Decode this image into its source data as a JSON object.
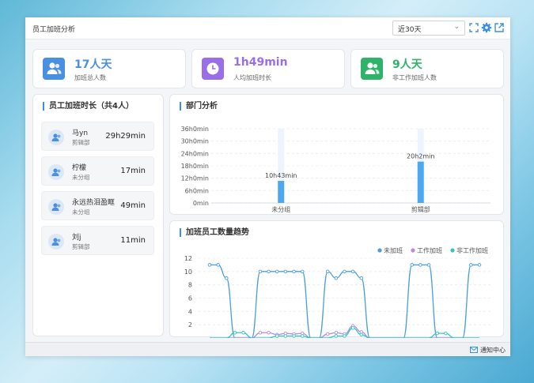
{
  "header": {
    "title": "员工加班分析",
    "range_selected": "近30天"
  },
  "stats": [
    {
      "value": "17人天",
      "label": "加班总人数",
      "color": "#4a90e2",
      "icon": "users-icon"
    },
    {
      "value": "1h49min",
      "label": "人均加班时长",
      "color": "#9a6ee6",
      "icon": "clock-icon"
    },
    {
      "value": "9人天",
      "label": "非工作加班人数",
      "color": "#2fb36b",
      "icon": "users-icon"
    }
  ],
  "employee_panel": {
    "title": "员工加班时长（共4人）",
    "items": [
      {
        "name": "马yn",
        "dept": "剪辑部",
        "duration": "29h29min"
      },
      {
        "name": "柠檬",
        "dept": "未分组",
        "duration": "17min"
      },
      {
        "name": "永远热泪盈眶",
        "dept": "未分组",
        "duration": "49min"
      },
      {
        "name": "刘j",
        "dept": "剪辑部",
        "duration": "11min"
      }
    ]
  },
  "dept_panel": {
    "title": "部门分析"
  },
  "trend_panel": {
    "title": "加班员工数量趋势"
  },
  "footer": {
    "notify_label": "通知中心"
  },
  "chart_data": [
    {
      "type": "bar",
      "categories": [
        "未分组",
        "剪辑部"
      ],
      "values": [
        10.72,
        20.03
      ],
      "value_labels": [
        "10h43min",
        "20h2min"
      ],
      "y_ticks": [
        "0min",
        "6h0min",
        "12h0min",
        "18h0min",
        "24h0min",
        "30h0min",
        "36h0min"
      ],
      "ylim": [
        0,
        36
      ],
      "color": "#4ea8f0"
    },
    {
      "type": "line",
      "y_ticks": [
        "2",
        "4",
        "6",
        "8",
        "10",
        "12"
      ],
      "ylim": [
        0,
        12
      ],
      "legend_position": "top-right",
      "series": [
        {
          "name": "未加班",
          "color": "#4a9fe0",
          "values": [
            11,
            11,
            9,
            0,
            0,
            0,
            10,
            10,
            10,
            10,
            10,
            10,
            0,
            0,
            10,
            9,
            10,
            10,
            9,
            0,
            0,
            0,
            0,
            0,
            11,
            11,
            11,
            0,
            0,
            0,
            0,
            11,
            11
          ]
        },
        {
          "name": "工作加班",
          "color": "#b58ae0",
          "values": [
            0,
            0,
            0,
            0,
            0,
            0,
            0.8,
            0.8,
            0.5,
            0.7,
            0.6,
            0.7,
            0,
            0,
            0.6,
            0.8,
            0.6,
            1.8,
            0.9,
            0,
            0,
            0,
            0,
            0,
            0,
            0,
            0,
            0,
            0,
            0,
            0,
            0,
            0
          ]
        },
        {
          "name": "非工作加班",
          "color": "#34c5c0",
          "values": [
            0,
            0,
            0,
            0.8,
            0.8,
            0,
            0,
            0,
            0.3,
            0.3,
            0.3,
            0.3,
            0,
            0,
            0,
            0.3,
            0.3,
            1.5,
            0.5,
            0,
            0,
            0,
            0,
            0,
            0,
            0,
            0,
            0.7,
            0.7,
            0,
            0,
            0,
            0
          ]
        }
      ]
    }
  ]
}
